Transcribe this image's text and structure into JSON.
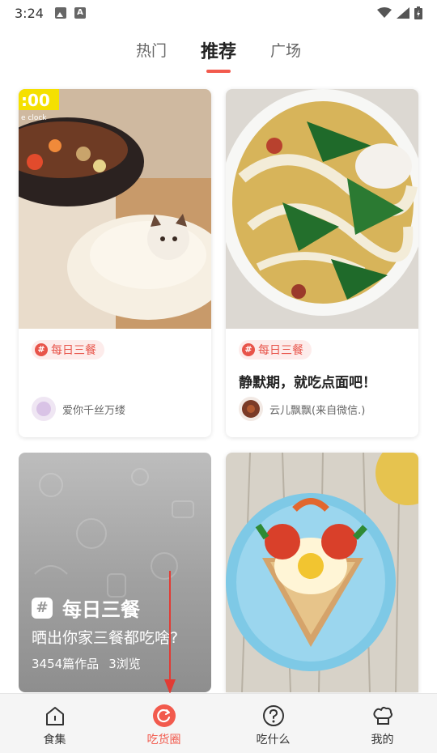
{
  "status_bar": {
    "time": "3:24"
  },
  "top_tabs": [
    {
      "label": "热门",
      "active": false
    },
    {
      "label": "推荐",
      "active": true
    },
    {
      "label": "广场",
      "active": false
    }
  ],
  "cards": [
    {
      "tag": "每日三餐",
      "title": "",
      "author": "爱你千丝万缕"
    },
    {
      "tag": "每日三餐",
      "title": "静默期，就吃点面吧！",
      "author": "云儿飘飘(来自微信.)"
    }
  ],
  "topic_card": {
    "heading": "每日三餐",
    "subtitle": "晒出你家三餐都吃啥?",
    "works": "3454篇作品",
    "views": "3浏览"
  },
  "bottom_nav": [
    {
      "label": "食集",
      "icon": "home-icon",
      "active": false
    },
    {
      "label": "吃货圈",
      "icon": "refresh-circle-icon",
      "active": true
    },
    {
      "label": "吃什么",
      "icon": "question-icon",
      "active": false
    },
    {
      "label": "我的",
      "icon": "chef-hat-icon",
      "active": false
    }
  ],
  "colors": {
    "accent": "#f25a4d",
    "tag_bg": "#fdeceb"
  }
}
